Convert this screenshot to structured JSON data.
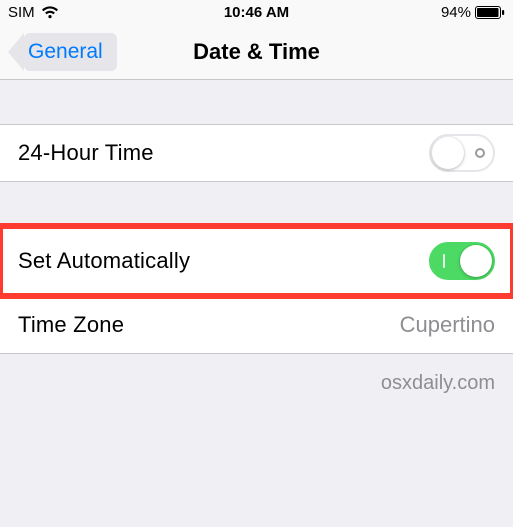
{
  "status": {
    "carrier": "SIM",
    "time": "10:46 AM",
    "battery_pct": "94%"
  },
  "nav": {
    "back_label": "General",
    "title": "Date & Time"
  },
  "rows": {
    "twenty_four_hour": {
      "label": "24-Hour Time",
      "on": false
    },
    "set_auto": {
      "label": "Set Automatically",
      "on": true
    },
    "time_zone": {
      "label": "Time Zone",
      "value": "Cupertino"
    }
  },
  "watermark": "osxdaily.com"
}
